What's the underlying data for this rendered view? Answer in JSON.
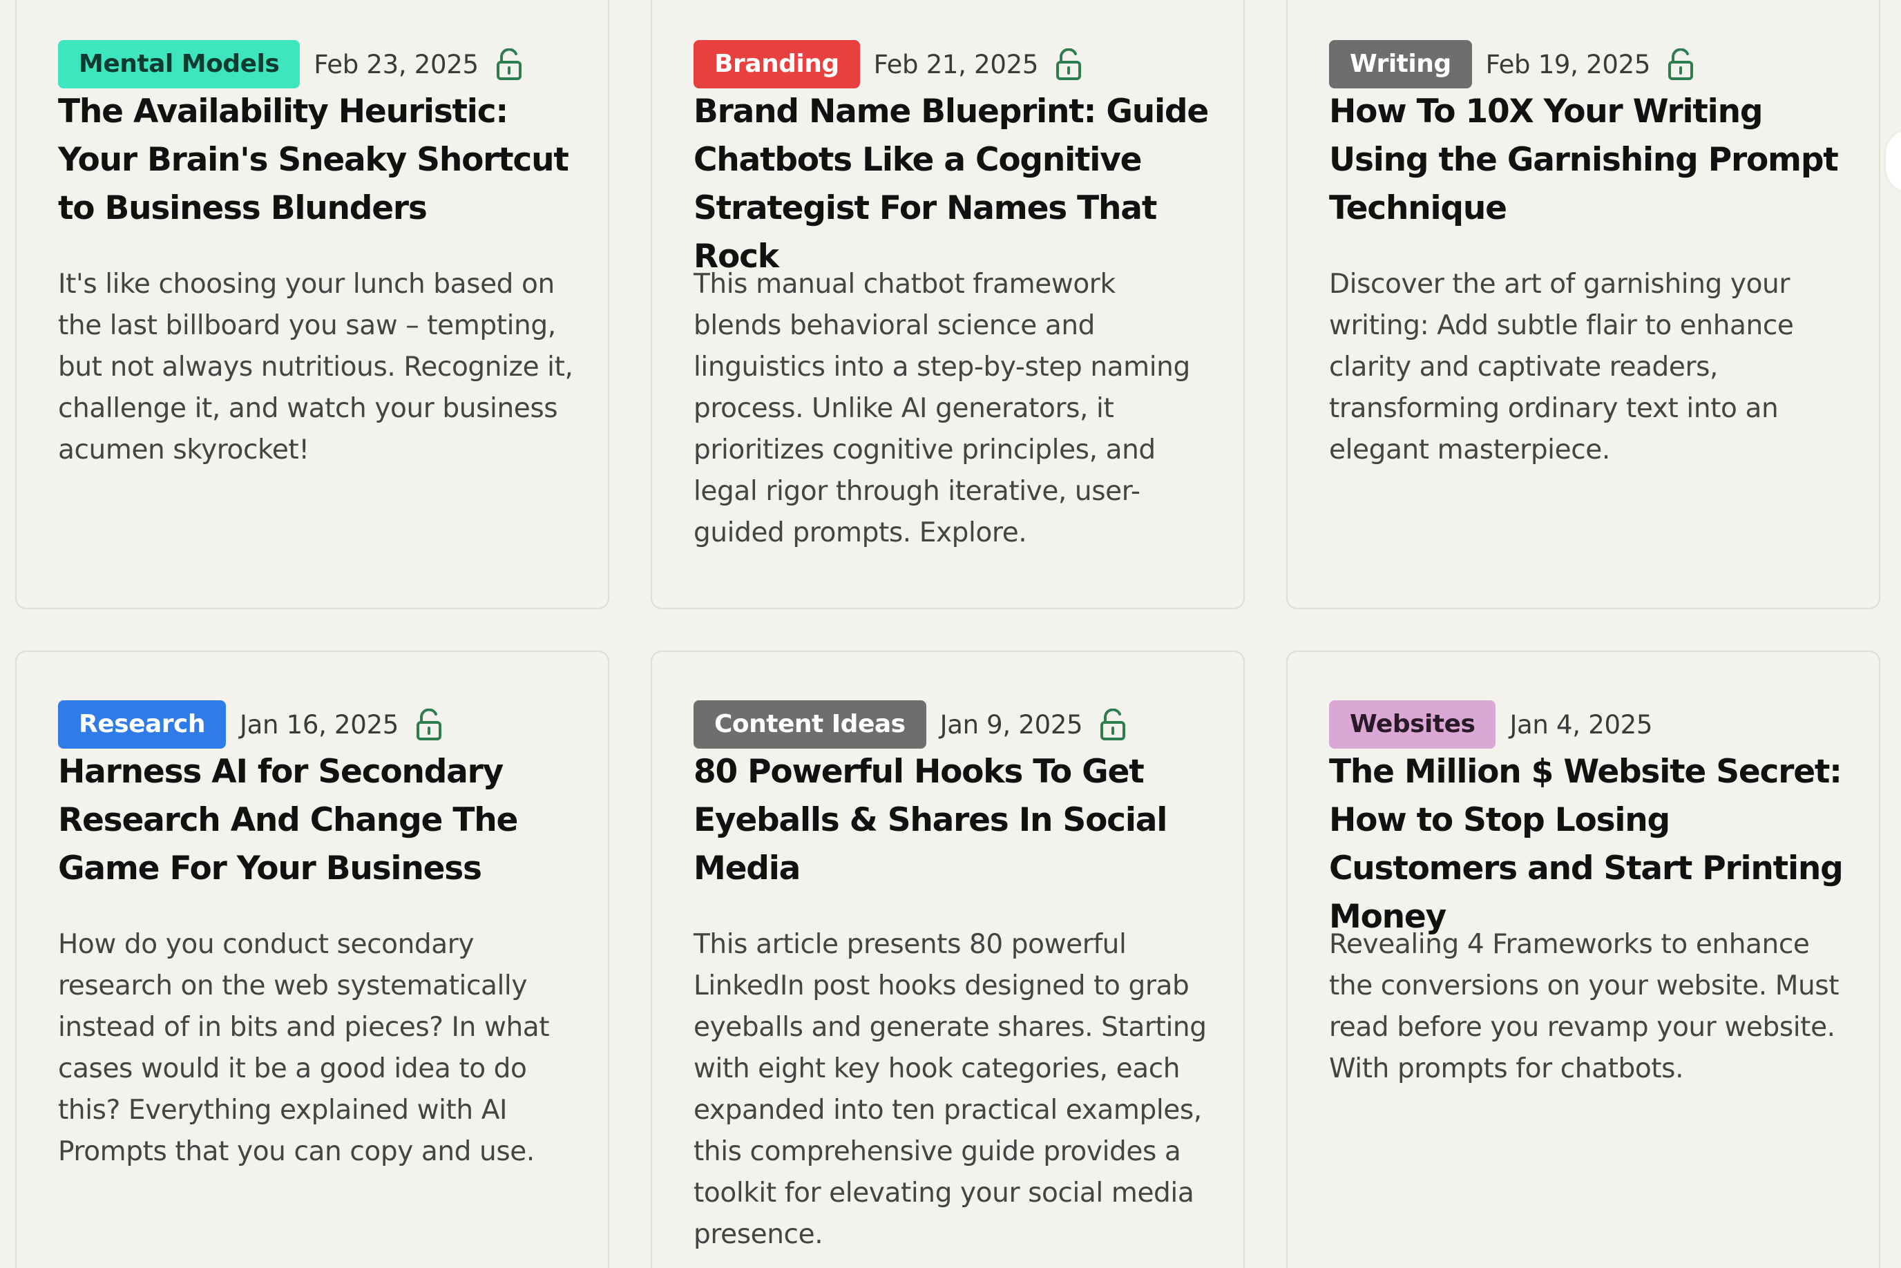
{
  "cards": [
    {
      "tag": "Mental Models",
      "tag_bg": "#3ee6c0",
      "tag_fg": "#0d3b30",
      "date": "Feb 23, 2025",
      "locked_icon": "unlock-icon",
      "title": "The Availability Heuristic: Your Brain's Sneaky Shortcut to Business Blunders",
      "description": "It's like choosing your lunch based on the last billboard you saw – tempting, but not always nutritious. Recognize it, challenge it, and watch your business acumen skyrocket!"
    },
    {
      "tag": "Branding",
      "tag_bg": "#e8403f",
      "tag_fg": "#ffffff",
      "date": "Feb 21, 2025",
      "locked_icon": "unlock-icon",
      "title": "Brand Name Blueprint: Guide Chatbots Like a Cognitive Strategist For Names That Rock",
      "description": "This manual chatbot framework blends behavioral science and linguistics into a step-by-step naming process. Unlike AI generators, it prioritizes cognitive principles, and legal rigor through iterative, user-guided prompts. Explore."
    },
    {
      "tag": "Writing",
      "tag_bg": "#6e6e6e",
      "tag_fg": "#ffffff",
      "date": "Feb 19, 2025",
      "locked_icon": "unlock-icon",
      "title": "How To 10X Your Writing Using the Garnishing Prompt Technique",
      "description": "Discover the art of garnishing your writing: Add subtle flair to enhance clarity and captivate readers, transforming ordinary text into an elegant masterpiece."
    },
    {
      "tag": "Research",
      "tag_bg": "#2f7be8",
      "tag_fg": "#ffffff",
      "date": "Jan 16, 2025",
      "locked_icon": "unlock-icon",
      "title": "Harness AI for Secondary Research And Change The Game For Your Business",
      "description": "How do you conduct secondary research on the web systematically instead of in bits and pieces? In what cases would it be a good idea to do this? Everything explained with AI Prompts that you can copy and use."
    },
    {
      "tag": "Content Ideas",
      "tag_bg": "#6e6e6e",
      "tag_fg": "#ffffff",
      "date": "Jan 9, 2025",
      "locked_icon": "unlock-icon",
      "title": "80 Powerful Hooks To Get Eyeballs & Shares In Social Media",
      "description": "This article presents 80 powerful LinkedIn post hooks designed to grab eyeballs and generate shares. Starting with eight key hook categories, each expanded into ten practical examples, this comprehensive guide provides a toolkit for elevating your social media presence."
    },
    {
      "tag": "Websites",
      "tag_bg": "#dba8d6",
      "tag_fg": "#2a1a28",
      "date": "Jan 4, 2025",
      "locked_icon": "",
      "title": "The Million $ Website Secret: How to Stop Losing Customers and Start Printing Money",
      "description": "Revealing 4 Frameworks to enhance the conversions on your website. Must read before you revamp your website. With prompts for chatbots."
    }
  ],
  "colors": {
    "background": "#f4f2ed",
    "card_border": "#e0ddd6",
    "lock_icon": "#2e7d4f"
  }
}
